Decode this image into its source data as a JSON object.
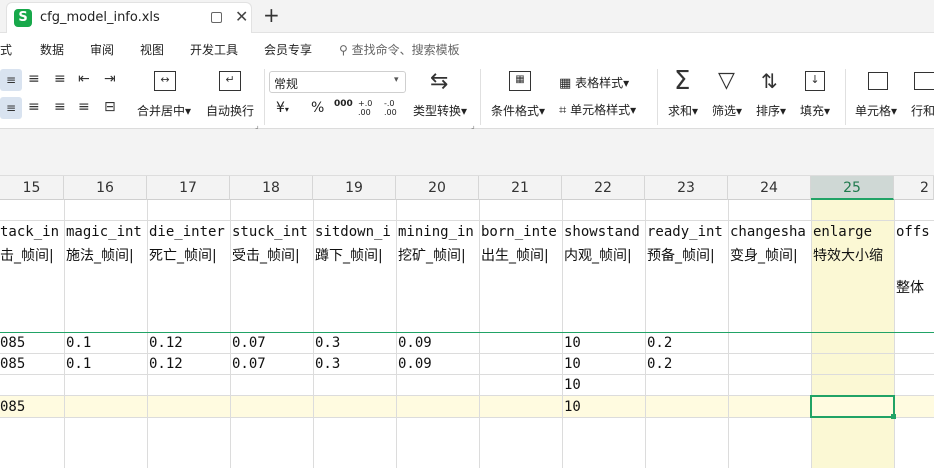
{
  "title_tab": {
    "logo": "S",
    "filename": "cfg_model_info.xls",
    "new_tab": "+"
  },
  "menu": {
    "items": [
      "式",
      "数据",
      "审阅",
      "视图",
      "开发工具",
      "会员专享"
    ],
    "search": "查找命令、搜索模板"
  },
  "ribbon": {
    "number_format": "常规",
    "merge": "合并居中",
    "wrap": "自动换行",
    "currency": "¥",
    "percent": "%",
    "thousands": "000",
    "dec_inc": "+.0 .00",
    "dec_dec": "-.0 .00",
    "type_convert": "类型转换",
    "cond_format": "条件格式",
    "table_style": "表格样式",
    "cell_style": "单元格样式",
    "sum": "求和",
    "filter": "筛选",
    "sort": "排序",
    "fill": "填充",
    "cells": "单元格",
    "rows_cols": "行和"
  },
  "columns": [
    "15",
    "16",
    "17",
    "18",
    "19",
    "20",
    "21",
    "22",
    "23",
    "24",
    "25",
    "2"
  ],
  "selected_column": "25",
  "rows": {
    "header_en": [
      "tack_in",
      "magic_int",
      "die_inter",
      "stuck_int",
      "sitdown_i",
      "mining_in",
      "born_inte",
      "showstand",
      "ready_int",
      "changesha",
      "enlarge",
      "offs"
    ],
    "header_cn": [
      "击_帧间|",
      "施法_帧间|",
      "死亡_帧间|",
      "受击_帧间|",
      "蹲下_帧间|",
      "挖矿_帧间|",
      "出生_帧间|",
      "内观_帧间|",
      "预备_帧间|",
      "变身_帧间|",
      "特效大小缩",
      ""
    ],
    "header_cn2": [
      "",
      "",
      "",
      "",
      "",
      "",
      "",
      "",
      "",
      "",
      "",
      "整体"
    ],
    "r1": [
      "085",
      "0.1",
      "0.12",
      "0.07",
      "0.3",
      "0.09",
      "",
      "10",
      "0.2",
      "",
      "",
      ""
    ],
    "r2": [
      "085",
      "0.1",
      "0.12",
      "0.07",
      "0.3",
      "0.09",
      "",
      "10",
      "0.2",
      "",
      "",
      ""
    ],
    "r3": [
      "",
      "",
      "",
      "",
      "",
      "",
      "",
      "10",
      "",
      "",
      "",
      ""
    ],
    "r4": [
      "085",
      "",
      "",
      "",
      "",
      "",
      "",
      "10",
      "",
      "",
      "",
      ""
    ]
  },
  "colors": {
    "accent": "#21a366",
    "highlight_row": "#fffbe0",
    "selected_col": "#fbf8d4"
  }
}
